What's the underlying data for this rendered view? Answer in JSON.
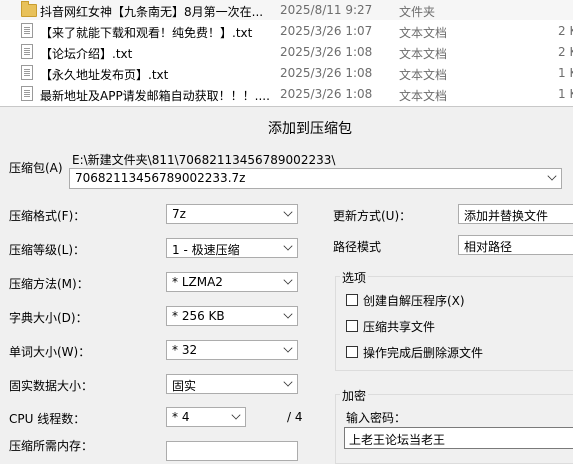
{
  "files": [
    {
      "icon": "folder-icon",
      "name": "抖音网红女神【九条南无】8月第一次在...",
      "date": "2025/8/11 9:27",
      "type": "文件夹",
      "size": ""
    },
    {
      "icon": "text-file-icon",
      "name": "【来了就能下载和观看！纯免费！】.txt",
      "date": "2025/3/26 1:07",
      "type": "文本文档",
      "size": "2 K"
    },
    {
      "icon": "text-file-icon",
      "name": "【论坛介绍】.txt",
      "date": "2025/3/26 1:08",
      "type": "文本文档",
      "size": "2 K"
    },
    {
      "icon": "text-file-icon",
      "name": "【永久地址发布页】.txt",
      "date": "2025/3/26 1:08",
      "type": "文本文档",
      "size": "1 K"
    },
    {
      "icon": "text-file-icon",
      "name": "最新地址及APP请发邮箱自动获取！！！....",
      "date": "2025/3/26 1:08",
      "type": "文本文档",
      "size": "1 K"
    }
  ],
  "dialog": {
    "title": "添加到压缩包",
    "archive_label": "压缩包(A)",
    "archive_path": "E:\\新建文件夹\\811\\70682113456789002233\\",
    "archive_name": "70682113456789002233.7z",
    "left": [
      {
        "label": "压缩格式(F)：",
        "value": "7z"
      },
      {
        "label": "压缩等级(L)：",
        "value": "1 - 极速压缩"
      },
      {
        "label": "压缩方法(M)：",
        "value": "* LZMA2"
      },
      {
        "label": "字典大小(D)：",
        "value": "* 256 KB"
      },
      {
        "label": "单词大小(W)：",
        "value": "* 32"
      },
      {
        "label": "固实数据大小：",
        "value": "固实"
      }
    ],
    "cpu_label": "CPU 线程数：",
    "cpu_value": "* 4",
    "cpu_total": "/ 4",
    "memory_label": "压缩所需内存：",
    "update_mode_label": "更新方式(U)：",
    "update_mode_value": "添加并替换文件",
    "path_mode_label": "路径模式",
    "path_mode_value": "相对路径",
    "options_title": "选项",
    "options": [
      "创建自解压程序(X)",
      "压缩共享文件",
      "操作完成后删除源文件"
    ],
    "encryption_title": "加密",
    "password_label": "输入密码：",
    "password_value": "上老王论坛当老王"
  }
}
